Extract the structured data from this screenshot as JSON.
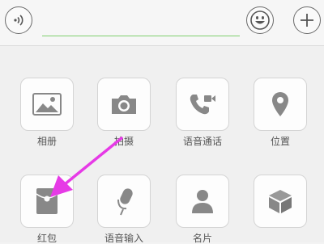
{
  "input_bar": {
    "left_icon": "voice-icon",
    "right_icons": [
      "emoji-icon",
      "plus-icon"
    ],
    "accent_color": "#7fcf6d"
  },
  "attachments": {
    "row1": [
      {
        "label": "相册",
        "icon": "photo-album-icon"
      },
      {
        "label": "拍摄",
        "icon": "camera-icon"
      },
      {
        "label": "语音通话",
        "icon": "voice-call-icon"
      },
      {
        "label": "位置",
        "icon": "location-pin-icon"
      }
    ],
    "row2": [
      {
        "label": "红包",
        "icon": "red-envelope-icon"
      },
      {
        "label": "语音输入",
        "icon": "microphone-icon"
      },
      {
        "label": "名片",
        "icon": "contact-card-icon"
      },
      {
        "label": "",
        "icon": "box-icon"
      }
    ]
  },
  "annotation": {
    "icon": "pointer-arrow-icon",
    "color": "#e63ae6"
  }
}
